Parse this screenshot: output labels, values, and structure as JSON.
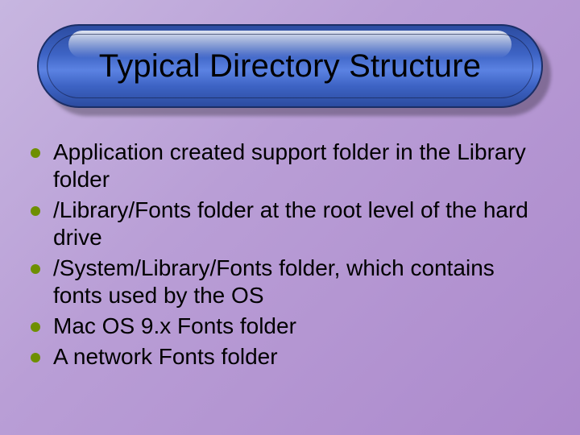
{
  "slide": {
    "title": "Typical Directory Structure",
    "bullets": [
      "Application created support folder in the Library folder",
      "/Library/Fonts folder at the root level of the hard drive",
      "/System/Library/Fonts folder, which contains fonts used by the OS",
      "Mac OS 9.x Fonts folder",
      "A network Fonts folder"
    ]
  }
}
